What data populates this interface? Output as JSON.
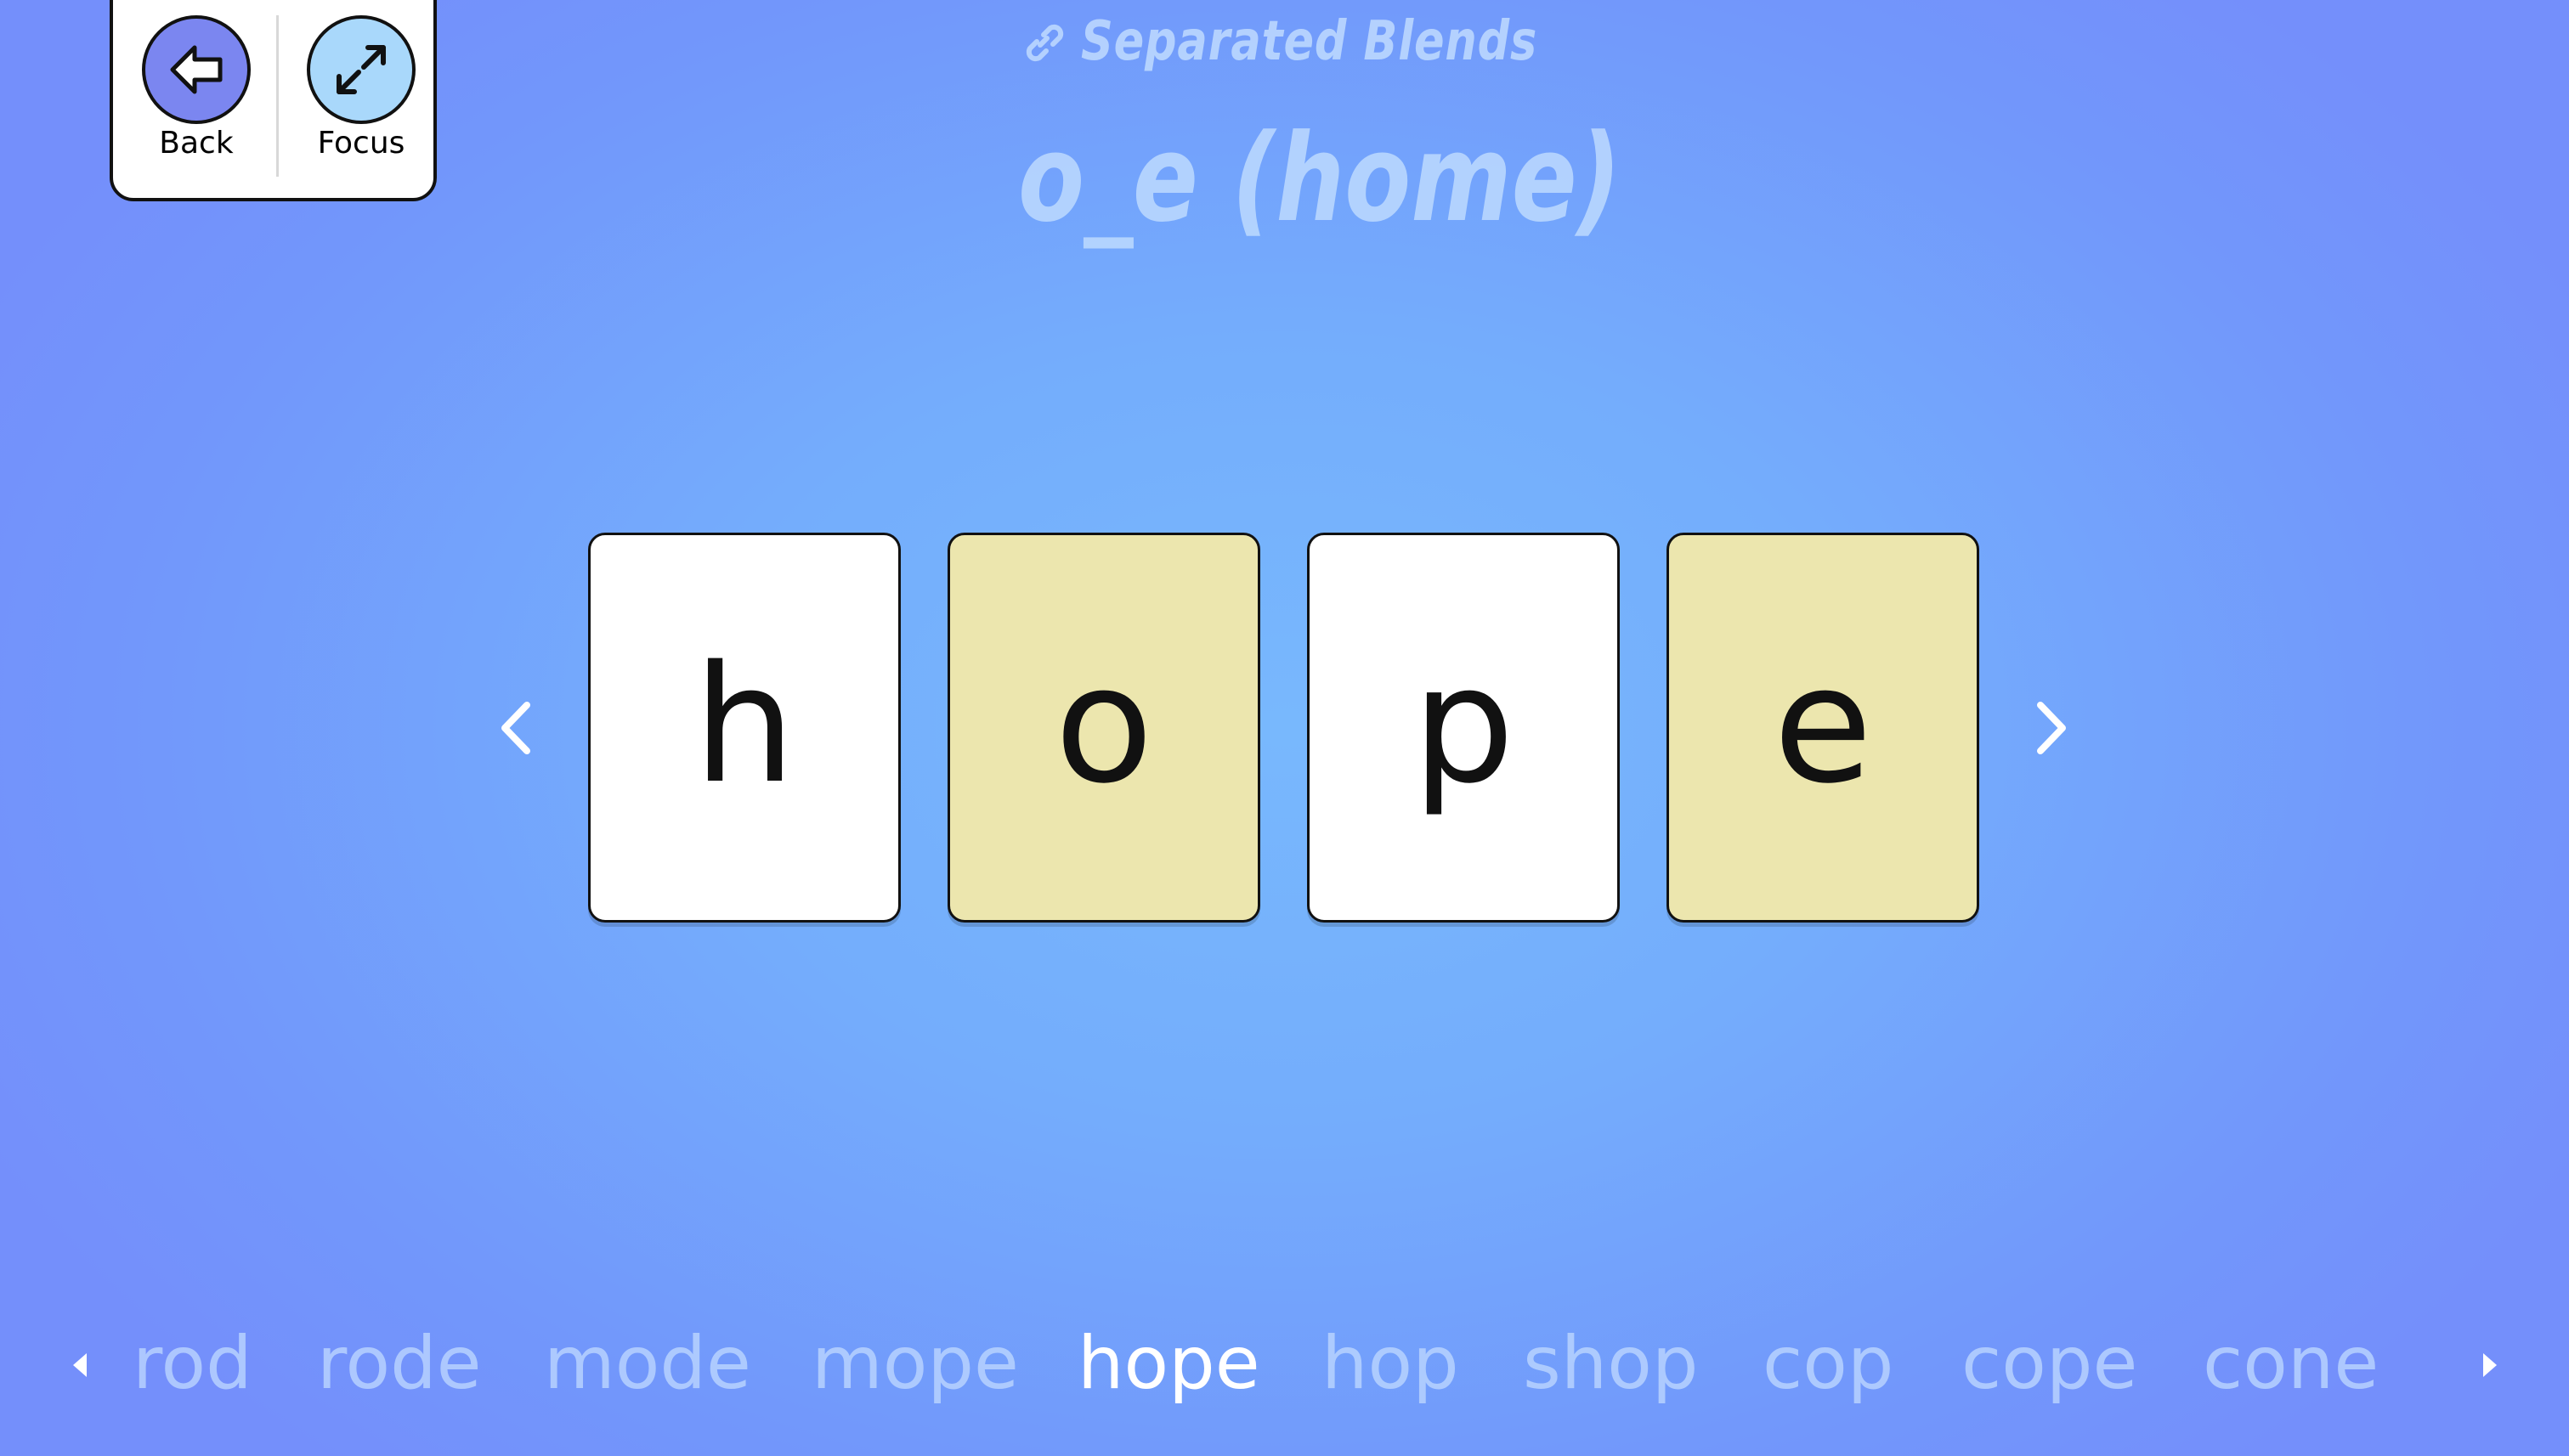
{
  "toolbar": {
    "back_label": "Back",
    "focus_label": "Focus"
  },
  "header": {
    "category": "Separated Blends",
    "lesson": "o_e (home)"
  },
  "cards": [
    {
      "letter": "h",
      "type": "consonant"
    },
    {
      "letter": "o",
      "type": "vowel"
    },
    {
      "letter": "p",
      "type": "consonant"
    },
    {
      "letter": "e",
      "type": "vowel"
    }
  ],
  "word_list": {
    "words": [
      "rod",
      "rode",
      "mode",
      "mope",
      "hope",
      "hop",
      "shop",
      "cop",
      "cope",
      "cone"
    ],
    "current": "hope"
  },
  "icons": {
    "back": "arrow-left-icon",
    "focus": "expand-arrows-icon",
    "category": "link-icon",
    "prev": "chevron-left-icon",
    "next": "chevron-right-icon"
  },
  "colors": {
    "vowel_card": "#ece6ae",
    "consonant_card": "#ffffff",
    "back_button": "#7b86f0",
    "focus_button": "#a9d8fb"
  }
}
